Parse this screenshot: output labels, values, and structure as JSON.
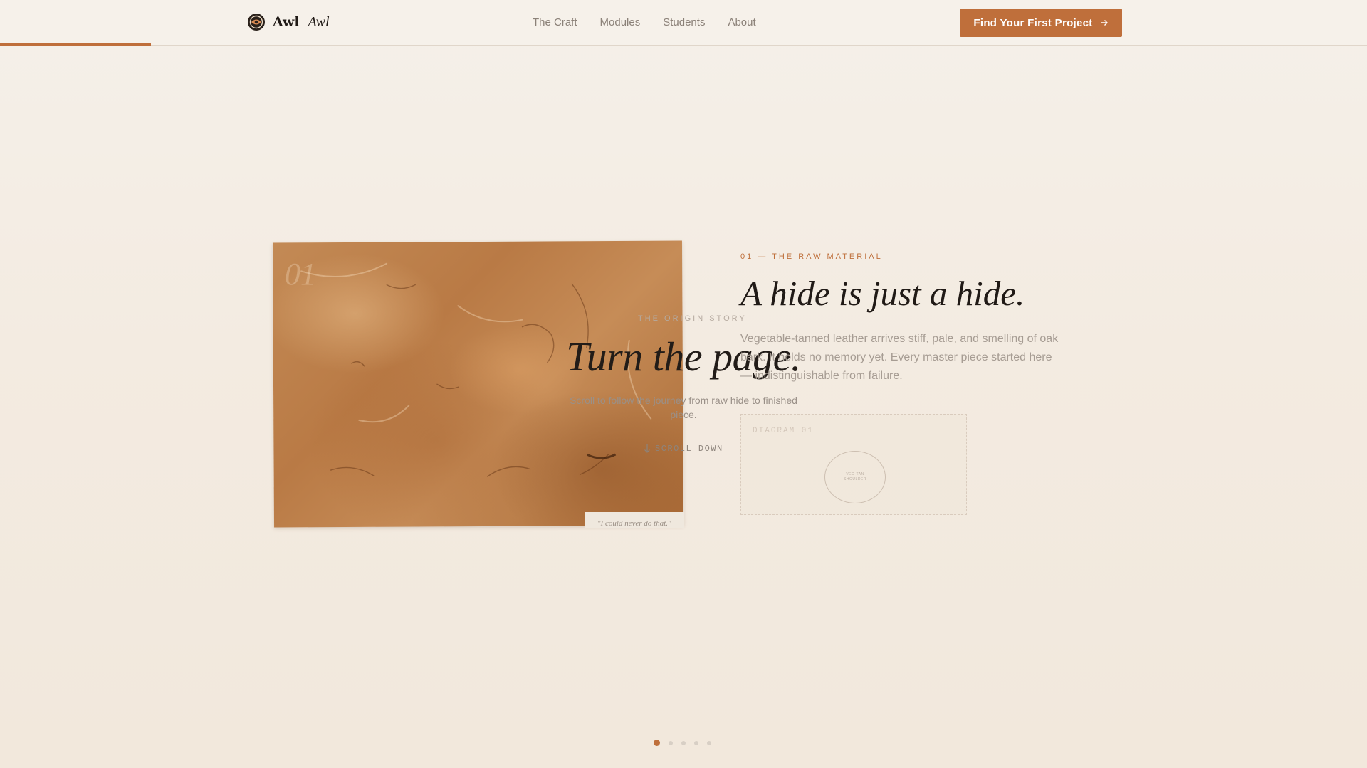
{
  "brand": {
    "name": "Awl",
    "alt": "Awl",
    "logo_icon": "compass-seal-icon"
  },
  "nav": {
    "items": [
      {
        "label": "The Craft"
      },
      {
        "label": "Modules"
      },
      {
        "label": "Students"
      },
      {
        "label": "About"
      }
    ]
  },
  "cta": {
    "label": "Find Your First Project",
    "icon": "arrow-right-icon"
  },
  "hero": {
    "eyebrow": "THE ORIGIN STORY",
    "title": "Turn the page.",
    "subtitle": "Scroll to follow the journey from raw hide to finished piece.",
    "scroll_label": "SCROLL DOWN"
  },
  "photo": {
    "number": "01",
    "quote": "\"I could never do that.\""
  },
  "section": {
    "eyebrow": "01 — THE RAW MATERIAL",
    "title": "A hide is just a hide.",
    "body": "Vegetable-tanned leather arrives stiff, pale, and smelling of oak bark. It holds no memory yet. Every master piece started here — indistinguishable from failure.",
    "diagram_label": "DIAGRAM 01",
    "diagram_text": [
      "VEG-TAN",
      "SHOULDER"
    ]
  },
  "pagination": {
    "count": 5,
    "active_index": 0
  },
  "colors": {
    "accent": "#bf6f3b",
    "background": "#f4ede4",
    "text": "#201a16"
  }
}
